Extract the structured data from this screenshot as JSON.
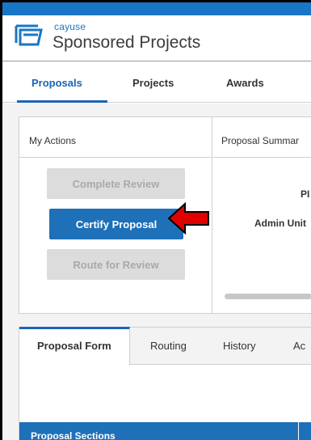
{
  "brand": {
    "company": "cayuse",
    "product": "Sponsored Projects",
    "accent_color": "#1976c6",
    "logo_icon": "cayuse-logo-icon"
  },
  "nav": {
    "items": [
      {
        "label": "Proposals",
        "active": true
      },
      {
        "label": "Projects",
        "active": false
      },
      {
        "label": "Awards",
        "active": false
      }
    ]
  },
  "my_actions": {
    "title": "My Actions",
    "buttons": {
      "complete_review": "Complete Review",
      "certify_proposal": "Certify Proposal",
      "route_for_review": "Route for Review"
    },
    "annotation_arrow_color": "#e00000"
  },
  "proposal_summary": {
    "title": "Proposal Summar",
    "pi_label": "PI",
    "admin_unit_label": "Admin Unit"
  },
  "tabs": {
    "items": [
      {
        "label": "Proposal Form",
        "active": true
      },
      {
        "label": "Routing",
        "active": false
      },
      {
        "label": "History",
        "active": false
      },
      {
        "label": "Ac",
        "active": false
      }
    ]
  },
  "sections": {
    "label": "Proposal Sections",
    "color": "#1e70b9"
  }
}
